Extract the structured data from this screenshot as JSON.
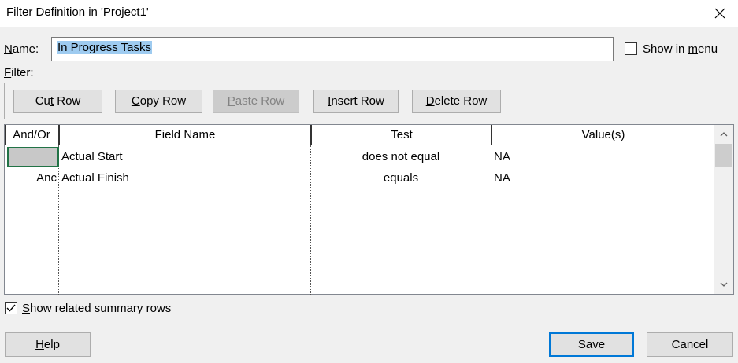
{
  "window": {
    "title": "Filter Definition in 'Project1'"
  },
  "name": {
    "label_mnemonic": "N",
    "label_rest": "ame:",
    "value": "In Progress Tasks"
  },
  "show_in_menu": {
    "label_pre": "Show in ",
    "label_mnemonic": "m",
    "label_post": "enu",
    "checked": false
  },
  "filter": {
    "label_mnemonic": "F",
    "label_rest": "ilter:"
  },
  "toolbar": {
    "cut": {
      "pre": "Cu",
      "mn": "t",
      "post": " Row"
    },
    "copy": {
      "pre": "",
      "mn": "C",
      "post": "opy Row"
    },
    "paste": {
      "pre": "",
      "mn": "P",
      "post": "aste Row",
      "disabled": true
    },
    "insert": {
      "pre": "",
      "mn": "I",
      "post": "nsert Row"
    },
    "delete": {
      "pre": "",
      "mn": "D",
      "post": "elete Row"
    }
  },
  "grid": {
    "columns": [
      "And/Or",
      "Field Name",
      "Test",
      "Value(s)"
    ],
    "rows": [
      {
        "andor": "",
        "field": "Actual Start",
        "test": "does not equal",
        "value": "NA"
      },
      {
        "andor": "Anc",
        "field": "Actual Finish",
        "test": "equals",
        "value": "NA"
      }
    ]
  },
  "summary_rows": {
    "label_mnemonic": "S",
    "label_rest": "how related summary rows",
    "checked": true
  },
  "footer": {
    "help": {
      "mn": "H",
      "post": "elp"
    },
    "save": "Save",
    "cancel": "Cancel"
  },
  "colors": {
    "dialog_bg": "#f0f0f0",
    "selection_highlight": "#9ecbf0",
    "default_button_border": "#0078d7",
    "active_cell_border": "#217346"
  }
}
